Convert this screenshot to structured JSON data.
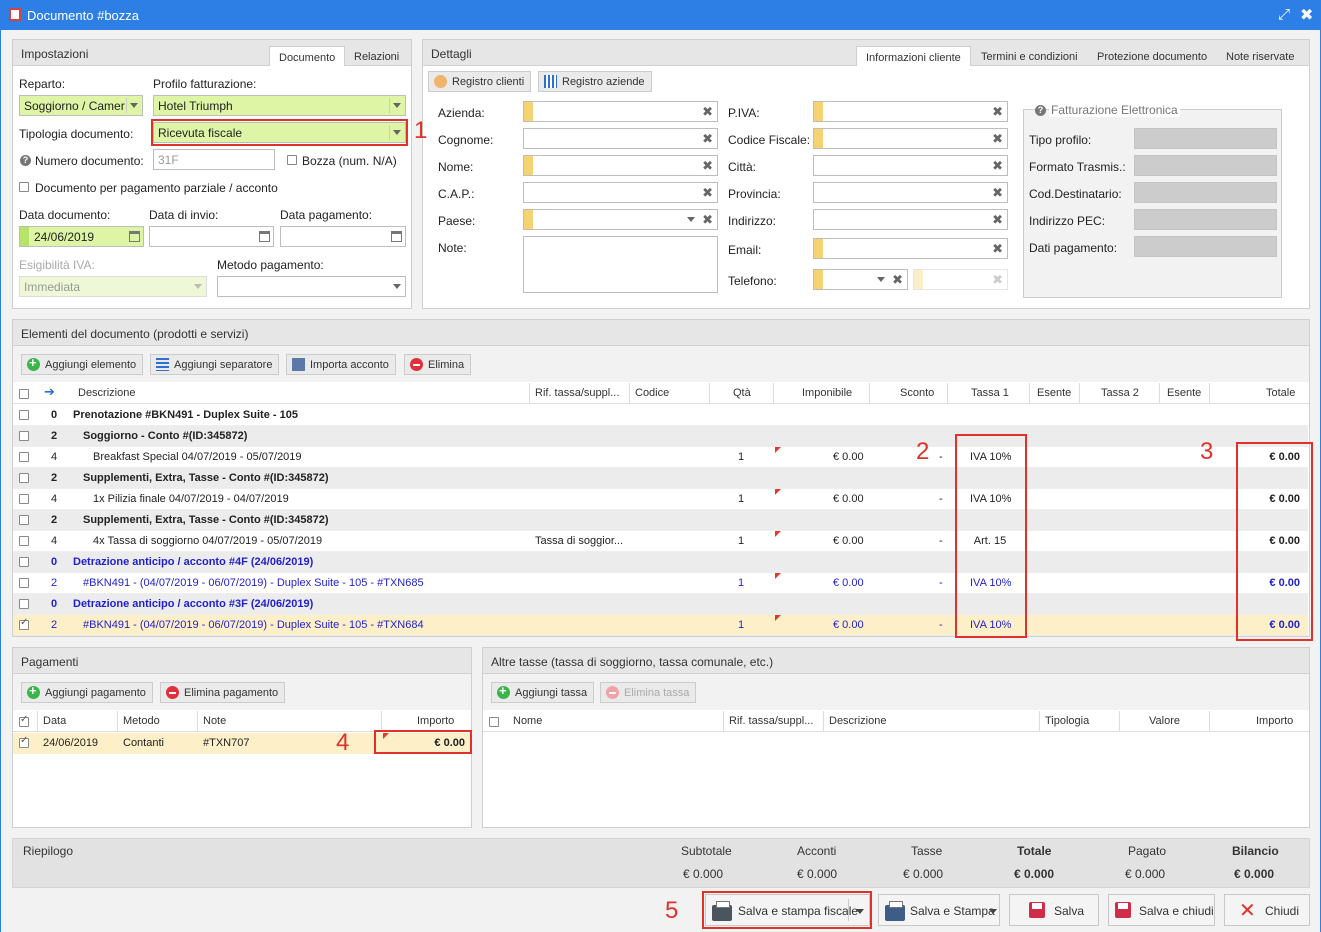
{
  "window": {
    "title": "Documento #bozza"
  },
  "settings": {
    "title": "Impostazioni",
    "tabs": [
      "Documento",
      "Relazioni"
    ],
    "reparto_label": "Reparto:",
    "reparto_value": "Soggiorno / Camer",
    "profilo_label": "Profilo fatturazione:",
    "profilo_value": "Hotel Triumph",
    "tipologia_label": "Tipologia documento:",
    "tipologia_value": "Ricevuta fiscale",
    "numero_label": "Numero documento:",
    "numero_value": "31F",
    "bozza_label": "Bozza (num. N/A)",
    "parziale_label": "Documento per pagamento parziale / acconto",
    "data_doc_label": "Data documento:",
    "data_doc_value": "24/06/2019",
    "data_invio_label": "Data di invio:",
    "data_pag_label": "Data pagamento:",
    "esig_label": "Esigibilità IVA:",
    "esig_value": "Immediata",
    "metodo_label": "Metodo pagamento:"
  },
  "details": {
    "title": "Dettagli",
    "tabs": [
      "Informazioni cliente",
      "Termini e condizioni",
      "Protezione documento",
      "Note riservate"
    ],
    "reg_clienti": "Registro clienti",
    "reg_aziende": "Registro aziende",
    "left_labels": [
      "Azienda:",
      "Cognome:",
      "Nome:",
      "C.A.P.:",
      "Paese:",
      "Note:"
    ],
    "mid_labels": [
      "P.IVA:",
      "Codice Fiscale:",
      "Città:",
      "Provincia:",
      "Indirizzo:",
      "Email:",
      "Telefono:"
    ],
    "fe_title": "Fatturazione Elettronica",
    "fe_labels": [
      "Tipo profilo:",
      "Formato Trasmis.:",
      "Cod.Destinatario:",
      "Indirizzo PEC:",
      "Dati pagamento:"
    ]
  },
  "items": {
    "title": "Elementi del documento (prodotti e servizi)",
    "btn_add": "Aggiungi elemento",
    "btn_sep": "Aggiungi separatore",
    "btn_import": "Importa acconto",
    "btn_delete": "Elimina",
    "headers": [
      "Descrizione",
      "Rif. tassa/suppl...",
      "Codice",
      "Qtà",
      "Imponibile",
      "Sconto",
      "Tassa 1",
      "Esente",
      "Tassa 2",
      "Esente",
      "Totale"
    ],
    "rows": [
      {
        "lvl": "0",
        "desc": "Prenotazione #BKN491 - Duplex Suite - 105",
        "rif": "",
        "qta": "",
        "imp": "",
        "sconto": "",
        "tassa": "",
        "tot": ""
      },
      {
        "lvl": "2",
        "desc": "Soggiorno - Conto #(ID:345872)",
        "rif": "",
        "qta": "",
        "imp": "",
        "sconto": "",
        "tassa": "",
        "tot": ""
      },
      {
        "lvl": "4",
        "desc": "Breakfast Special 04/07/2019 - 05/07/2019",
        "rif": "",
        "qta": "1",
        "imp": "€ 0.00",
        "sconto": "-",
        "tassa": "IVA 10%",
        "tot": "€ 0.00"
      },
      {
        "lvl": "2",
        "desc": "Supplementi, Extra, Tasse - Conto #(ID:345872)",
        "rif": "",
        "qta": "",
        "imp": "",
        "sconto": "",
        "tassa": "",
        "tot": ""
      },
      {
        "lvl": "4",
        "desc": "1x Pilizia finale 04/07/2019 - 04/07/2019",
        "rif": "",
        "qta": "1",
        "imp": "€ 0.00",
        "sconto": "-",
        "tassa": "IVA 10%",
        "tot": "€ 0.00"
      },
      {
        "lvl": "2",
        "desc": "Supplementi, Extra, Tasse - Conto #(ID:345872)",
        "rif": "",
        "qta": "",
        "imp": "",
        "sconto": "",
        "tassa": "",
        "tot": ""
      },
      {
        "lvl": "4",
        "desc": "4x Tassa di soggiorno 04/07/2019 - 05/07/2019",
        "rif": "Tassa di soggior...",
        "qta": "1",
        "imp": "€ 0.00",
        "sconto": "-",
        "tassa": "Art. 15",
        "tot": "€ 0.00"
      },
      {
        "lvl": "0",
        "desc": "Detrazione anticipo / acconto #4F (24/06/2019)",
        "rif": "",
        "qta": "",
        "imp": "",
        "sconto": "",
        "tassa": "",
        "tot": ""
      },
      {
        "lvl": "2",
        "desc": "#BKN491 - (04/07/2019 - 06/07/2019) - Duplex Suite - 105 - #TXN685",
        "rif": "",
        "qta": "1",
        "imp": "€ 0.00",
        "sconto": "-",
        "tassa": "IVA 10%",
        "tot": "€ 0.00"
      },
      {
        "lvl": "0",
        "desc": "Detrazione anticipo / acconto #3F (24/06/2019)",
        "rif": "",
        "qta": "",
        "imp": "",
        "sconto": "",
        "tassa": "",
        "tot": ""
      },
      {
        "lvl": "2",
        "desc": "#BKN491 - (04/07/2019 - 06/07/2019) - Duplex Suite - 105 - #TXN684",
        "rif": "",
        "qta": "1",
        "imp": "€ 0.00",
        "sconto": "-",
        "tassa": "IVA 10%",
        "tot": "€ 0.00"
      }
    ]
  },
  "payments": {
    "title": "Pagamenti",
    "btn_add": "Aggiungi pagamento",
    "btn_delete": "Elimina pagamento",
    "headers": [
      "Data",
      "Metodo",
      "Note",
      "Importo"
    ],
    "row": {
      "data": "24/06/2019",
      "metodo": "Contanti",
      "note": "#TXN707",
      "importo": "€ 0.00"
    }
  },
  "taxes": {
    "title": "Altre tasse (tassa di soggiorno, tassa comunale, etc.)",
    "btn_add": "Aggiungi tassa",
    "btn_delete": "Elimina tassa",
    "headers": [
      "Nome",
      "Rif. tassa/suppl...",
      "Descrizione",
      "Tipologia",
      "Valore",
      "Importo"
    ]
  },
  "summary": {
    "title": "Riepilogo",
    "headers": [
      "Subtotale",
      "Acconti",
      "Tasse",
      "Totale",
      "Pagato",
      "Bilancio"
    ],
    "values": [
      "€ 0.000",
      "€ 0.000",
      "€ 0.000",
      "€ 0.000",
      "€ 0.000",
      "€ 0.000"
    ]
  },
  "footer": {
    "btn_stampa_fiscale": "Salva e stampa fiscale",
    "btn_salva_stampa": "Salva e Stampa",
    "btn_salva": "Salva",
    "btn_salva_chiudi": "Salva e chiudi",
    "btn_chiudi": "Chiudi"
  },
  "annotations": [
    "1",
    "2",
    "3",
    "4",
    "5"
  ],
  "colors": {
    "titlebar": "#2d7fe6",
    "annotation_red": "#e0312b",
    "required_yellow": "#f5d272",
    "field_green": "#dff5a6",
    "link_blue": "#1f1fd0"
  }
}
